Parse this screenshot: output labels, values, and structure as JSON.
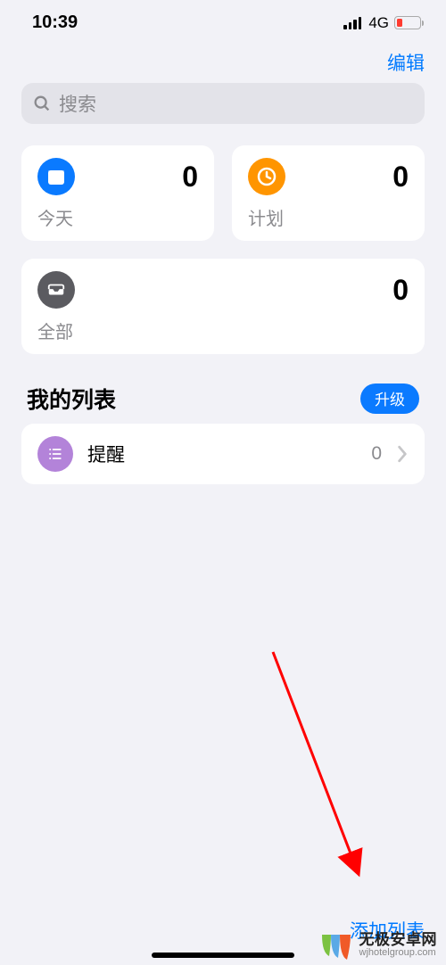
{
  "status": {
    "time": "10:39",
    "network": "4G"
  },
  "nav": {
    "edit": "编辑"
  },
  "search": {
    "placeholder": "搜索"
  },
  "cards": {
    "today": {
      "label": "今天",
      "count": "0"
    },
    "scheduled": {
      "label": "计划",
      "count": "0"
    },
    "all": {
      "label": "全部",
      "count": "0"
    }
  },
  "section": {
    "title": "我的列表",
    "upgrade": "升级"
  },
  "lists": [
    {
      "title": "提醒",
      "count": "0"
    }
  ],
  "toolbar": {
    "add_list": "添加列表"
  },
  "watermark": {
    "title": "无极安卓网",
    "sub": "wjhotelgroup.com"
  }
}
